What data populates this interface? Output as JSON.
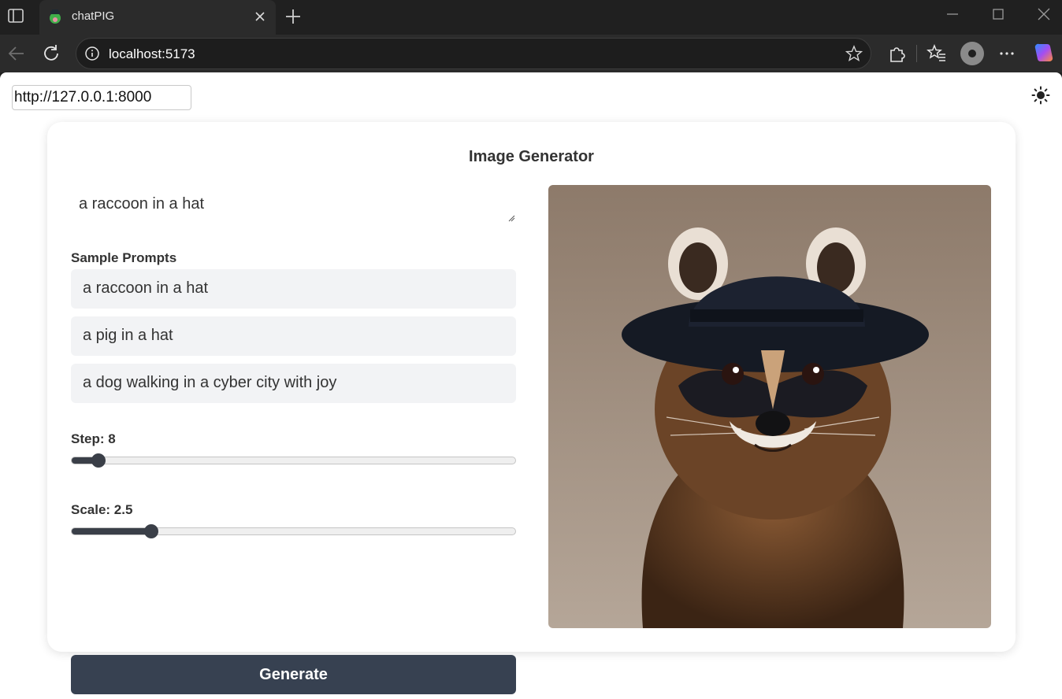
{
  "browser": {
    "tab_title": "chatPIG",
    "url": "localhost:5173"
  },
  "page": {
    "api_url": "http://127.0.0.1:8000",
    "title": "Image Generator",
    "prompt": "a raccoon in a hat",
    "sample_prompts_label": "Sample Prompts",
    "sample_prompts": [
      "a raccoon in a hat",
      "a pig in a hat",
      "a dog walking in a cyber city with joy"
    ],
    "step_label": "Step: 8",
    "step_fraction": 0.06,
    "scale_label": "Scale: 2.5",
    "scale_fraction": 0.18,
    "generate_label": "Generate",
    "image_icon": "raccoon-in-black-hat"
  },
  "colors": {
    "button_bg": "#374151",
    "sample_bg": "#f2f3f5",
    "chrome_bg": "#202020"
  }
}
